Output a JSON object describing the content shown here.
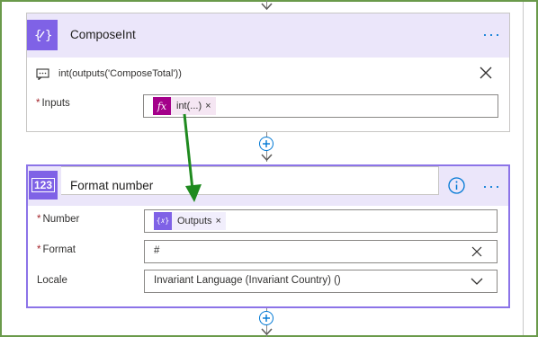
{
  "compose_card": {
    "title": "ComposeInt",
    "more_label": "···",
    "comment_text": "int(outputs('ComposeTotal'))",
    "inputs_label": "Inputs",
    "required_mark": "*",
    "token_label": "int(...)",
    "token_icon": "fx",
    "token_remove": "×"
  },
  "format_card": {
    "title": "Format number",
    "icon_text": "123",
    "more_label": "···",
    "info_label": "i",
    "number_label": "Number",
    "number_token": "Outputs",
    "number_token_icon": "{𝑥}",
    "number_token_remove": "×",
    "format_label": "Format",
    "format_value": "#",
    "locale_label": "Locale",
    "locale_value": "Invariant Language (Invariant Country) ()"
  },
  "colors": {
    "accent_purple": "#7f62e6",
    "header_bg": "#ebe6fa",
    "fx_token": "#a4008a",
    "link_blue": "#0078d4",
    "arrow_green": "#1f8a1f",
    "frame_green": "#6a9a4b"
  }
}
